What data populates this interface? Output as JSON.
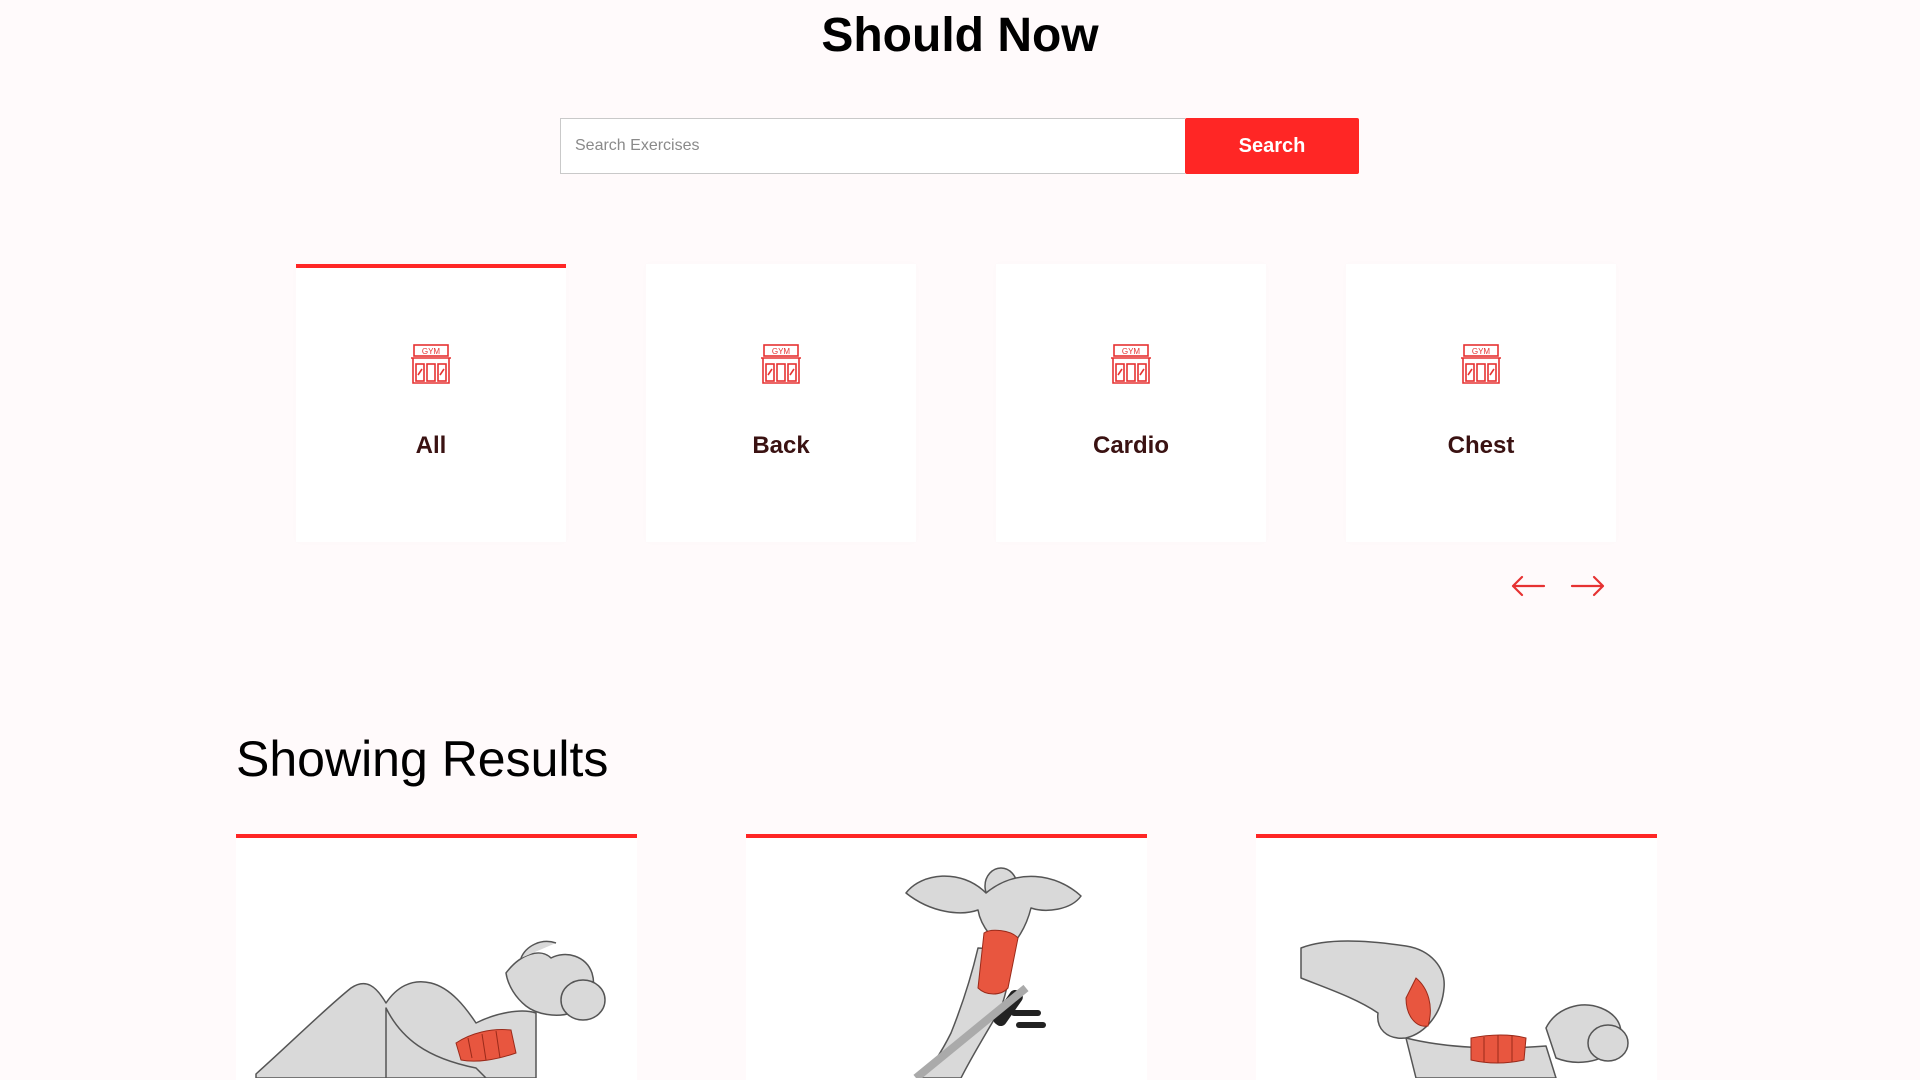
{
  "page": {
    "title": "Should Now"
  },
  "search": {
    "placeholder": "Search Exercises",
    "value": "",
    "button_label": "Search"
  },
  "categories": {
    "items": [
      {
        "label": "All",
        "icon": "gym-icon",
        "active": true
      },
      {
        "label": "Back",
        "icon": "gym-icon",
        "active": false
      },
      {
        "label": "Cardio",
        "icon": "gym-icon",
        "active": false
      },
      {
        "label": "Chest",
        "icon": "gym-icon",
        "active": false
      }
    ],
    "prev_icon": "arrow-left-icon",
    "next_icon": "arrow-right-icon"
  },
  "results": {
    "title": "Showing Results",
    "cards": [
      {
        "image": "crunch-exercise-image"
      },
      {
        "image": "decline-situp-exercise-image"
      },
      {
        "image": "reverse-crunch-exercise-image"
      }
    ]
  },
  "colors": {
    "accent": "#ff2625",
    "background": "#fffafb",
    "card": "#ffffff",
    "label": "#3a1212"
  }
}
